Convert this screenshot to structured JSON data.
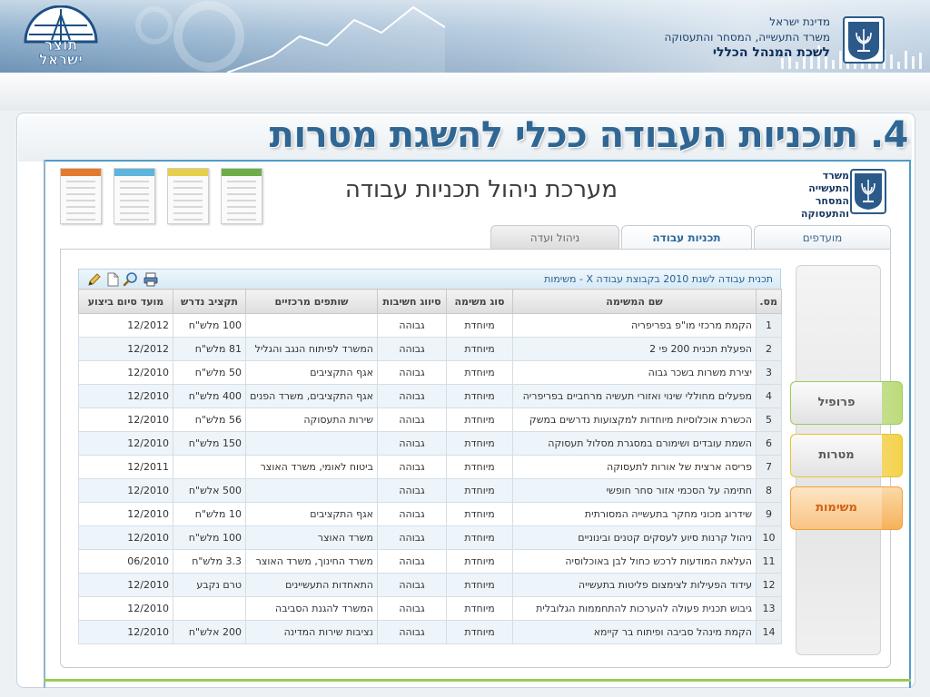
{
  "banner": {
    "logo_text_top": "תוצר",
    "logo_text_bottom": "ישראל",
    "ministry_line1": "מדינת ישראל",
    "ministry_line2": "משרד התעשייה, המסחר והתעסוקה",
    "ministry_line3": "לשכת המנהל הכללי"
  },
  "slide": {
    "title": "4. תוכניות העבודה ככלי להשגת מטרות"
  },
  "app": {
    "ministry_short": [
      "משרד",
      "התעשייה",
      "המסחר",
      "והתעסוקה"
    ],
    "name": "מערכת ניהול תכניות עבודה",
    "thumb_colors": [
      "#e47a2e",
      "#5db4dd",
      "#e8cf4a",
      "#6cae48"
    ]
  },
  "tabs": [
    {
      "label": "מועדפים"
    },
    {
      "label": "תכניות עבודה"
    },
    {
      "label": "ניהול ועדה"
    }
  ],
  "sidebar": {
    "profile": "פרופיל",
    "goals": "מטרות",
    "tasks": "משימות"
  },
  "grid": {
    "title": "תכנית עבודה לשנת 2010 בקבוצת עבודה X  - משימות",
    "columns": {
      "num": "מס.",
      "name": "שם המשימה",
      "type": "סוג משימה",
      "priority": "סיווג חשיבות",
      "partners": "שותפים מרכזיים",
      "budget": "תקציב נדרש",
      "due": "מועד סיום ביצוע"
    },
    "rows": [
      {
        "num": "1",
        "name": "הקמת מרכזי מו\"פ בפריפריה",
        "type": "מיוחדת",
        "priority": "גבוהה",
        "partners": "",
        "budget": "100 מלש\"ח",
        "due": "12/2012"
      },
      {
        "num": "2",
        "name": "הפעלת תכנית 200 פי 2",
        "type": "מיוחדת",
        "priority": "גבוהה",
        "partners": "המשרד לפיתוח הנגב והגליל",
        "budget": "81 מלש\"ח",
        "due": "12/2012"
      },
      {
        "num": "3",
        "name": "יצירת משרות בשכר גבוה",
        "type": "מיוחדת",
        "priority": "גבוהה",
        "partners": "אגף התקציבים",
        "budget": "50 מלש\"ח",
        "due": "12/2010"
      },
      {
        "num": "4",
        "name": "מפעלים מחוללי שינוי ואזורי תעשיה מרחביים בפריפריה",
        "type": "מיוחדת",
        "priority": "גבוהה",
        "partners": "אגף התקציבים, משרד הפנים",
        "budget": "400 מלש\"ח",
        "due": "12/2010"
      },
      {
        "num": "5",
        "name": "הכשרת אוכלוסיות מיוחדות למקצועות נדרשים במשק",
        "type": "מיוחדת",
        "priority": "גבוהה",
        "partners": "שירות התעסוקה",
        "budget": "56 מלש\"ח",
        "due": "12/2010"
      },
      {
        "num": "6",
        "name": "השמת עובדים ושימורם במסגרת מסלול תעסוקה",
        "type": "מיוחדת",
        "priority": "גבוהה",
        "partners": "",
        "budget": "150 מלש\"ח",
        "due": "12/2010"
      },
      {
        "num": "7",
        "name": "פריסה ארצית של אורות לתעסוקה",
        "type": "מיוחדת",
        "priority": "גבוהה",
        "partners": "ביטוח לאומי, משרד האוצר",
        "budget": "",
        "due": "12/2011"
      },
      {
        "num": "8",
        "name": "חתימה על הסכמי אזור סחר חופשי",
        "type": "מיוחדת",
        "priority": "גבוהה",
        "partners": "",
        "budget": "500 אלש\"ח",
        "due": "12/2010"
      },
      {
        "num": "9",
        "name": "שידרוג מכוני מחקר בתעשייה המסורתית",
        "type": "מיוחדת",
        "priority": "גבוהה",
        "partners": "אגף התקציבים",
        "budget": "10 מלש\"ח",
        "due": "12/2010"
      },
      {
        "num": "10",
        "name": "ניהול קרנות סיוע לעסקים קטנים ובינוניים",
        "type": "מיוחדת",
        "priority": "גבוהה",
        "partners": "משרד האוצר",
        "budget": "100 מלש\"ח",
        "due": "12/2010"
      },
      {
        "num": "11",
        "name": "העלאת המודעות לרכש כחול לבן באוכלוסיה",
        "type": "מיוחדת",
        "priority": "גבוהה",
        "partners": "משרד החינוך, משרד האוצר",
        "budget": "3.3 מלש\"ח",
        "due": "06/2010"
      },
      {
        "num": "12",
        "name": "עידוד הפעילות לצימצום פליטות בתעשייה",
        "type": "מיוחדת",
        "priority": "גבוהה",
        "partners": "התאחדות התעשיינים",
        "budget": "טרם נקבע",
        "due": "12/2010"
      },
      {
        "num": "13",
        "name": "גיבוש תכנית פעולה להערכות להתחממות הגלובלית",
        "type": "מיוחדת",
        "priority": "גבוהה",
        "partners": "המשרד להגנת הסביבה",
        "budget": "",
        "due": "12/2010"
      },
      {
        "num": "14",
        "name": "הקמת מינהל סביבה ופיתוח בר קיימא",
        "type": "מיוחדת",
        "priority": "גבוהה",
        "partners": "נציבות שירות המדינה",
        "budget": "200 אלש\"ח",
        "due": "12/2010"
      }
    ]
  }
}
